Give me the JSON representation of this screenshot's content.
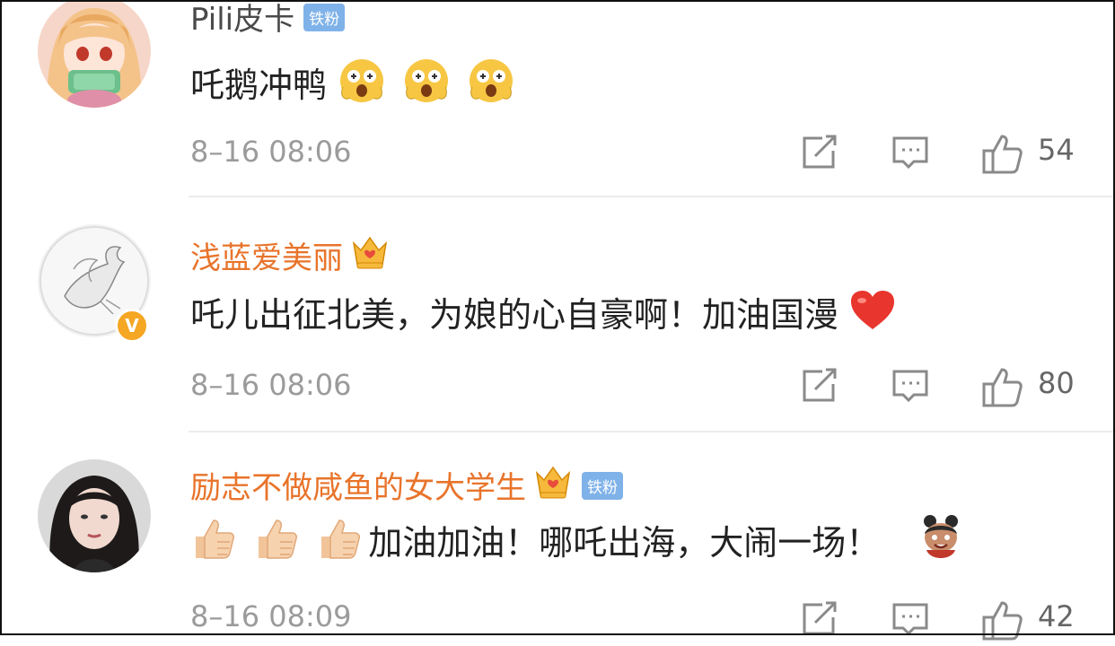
{
  "comments": [
    {
      "username": "Pili皮卡",
      "badge": "铁粉",
      "text": "吒鹅冲鸭",
      "emoji": [
        "surprised-emoji",
        "surprised-emoji",
        "surprised-emoji"
      ],
      "time": "8–16 08:06",
      "likes": "54",
      "avatar": "anime-girl-avatar"
    },
    {
      "username": "浅蓝爱美丽",
      "crown": "crown-badge",
      "text": "吒儿出征北美，为娘的心自豪啊！加油国漫",
      "emoji_after": "heart-emoji",
      "verified": "V",
      "time": "8–16 08:06",
      "likes": "80",
      "avatar": "dove-avatar"
    },
    {
      "username": "励志不做咸鱼的女大学生",
      "crown": "crown-badge",
      "badge": "铁粉",
      "text": "加油加油！哪吒出海，大闹一场！",
      "emoji_before": [
        "thumbs-up-emoji",
        "thumbs-up-emoji",
        "thumbs-up-emoji"
      ],
      "emoji_after": "nezha-sticker",
      "time": "8–16 08:09",
      "likes": "42",
      "avatar": "girl-photo-avatar"
    }
  ],
  "icons": {
    "share": "share-icon",
    "reply": "reply-icon",
    "like": "thumbs-up-icon"
  },
  "colors": {
    "username_vip": "#e8742b",
    "fan_badge": "#7fb2e8",
    "meta": "#9b9b9b",
    "verified": "#f5a623"
  }
}
